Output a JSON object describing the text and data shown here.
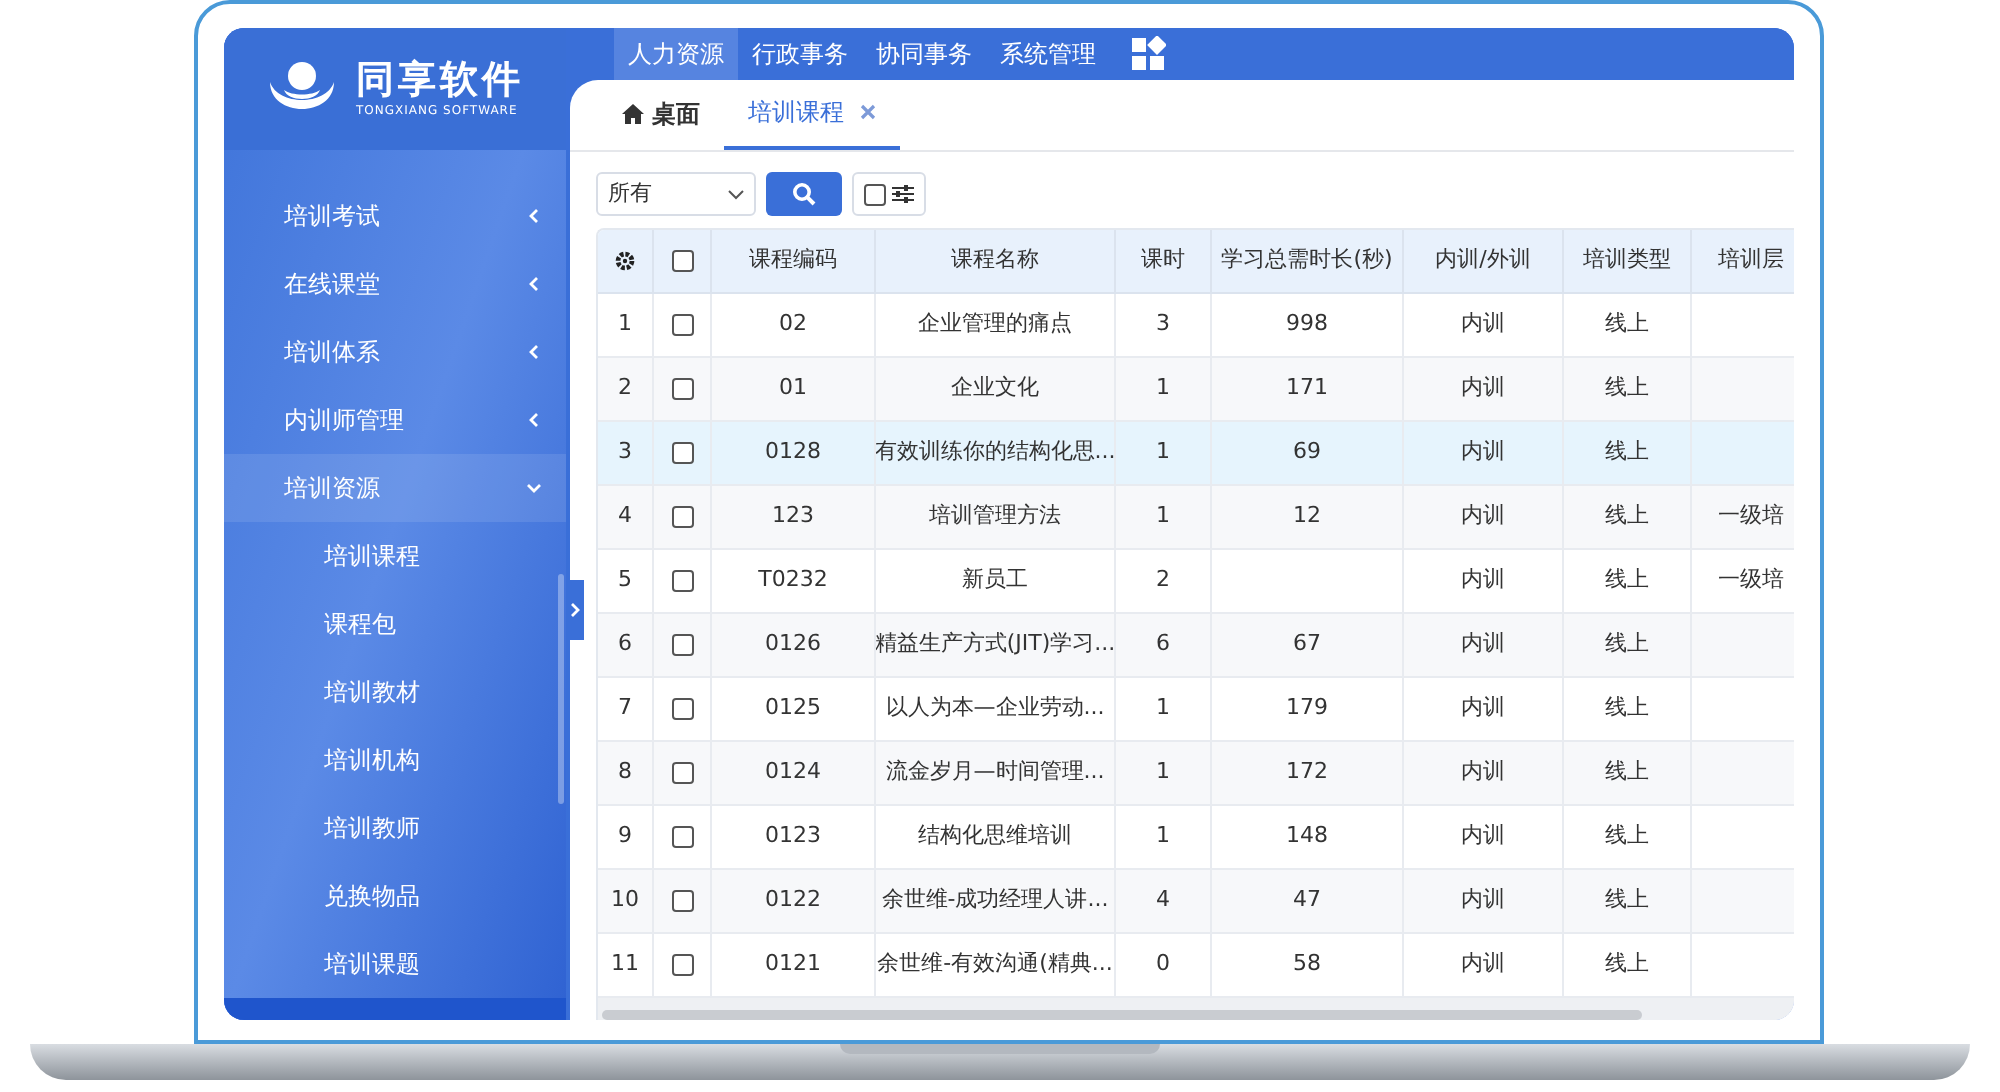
{
  "logo": {
    "name": "同享软件",
    "subtitle": "TONGXIANG SOFTWARE"
  },
  "top_nav": [
    {
      "label": "人力资源",
      "selected": true
    },
    {
      "label": "行政事务",
      "selected": false
    },
    {
      "label": "协同事务",
      "selected": false
    },
    {
      "label": "系统管理",
      "selected": false
    }
  ],
  "sidebar": {
    "items": [
      {
        "label": "培训考试",
        "expanded": false
      },
      {
        "label": "在线课堂",
        "expanded": false
      },
      {
        "label": "培训体系",
        "expanded": false
      },
      {
        "label": "内训师管理",
        "expanded": false
      },
      {
        "label": "培训资源",
        "expanded": true,
        "children": [
          {
            "label": "培训课程"
          },
          {
            "label": "课程包"
          },
          {
            "label": "培训教材"
          },
          {
            "label": "培训机构"
          },
          {
            "label": "培训教师"
          },
          {
            "label": "兑换物品"
          },
          {
            "label": "培训课题"
          }
        ]
      }
    ]
  },
  "tabs": [
    {
      "label": "桌面",
      "kind": "home",
      "selected": false
    },
    {
      "label": "培训课程",
      "kind": "closable",
      "selected": true
    }
  ],
  "toolbar": {
    "filter": "所有",
    "toggle_checked": false
  },
  "table": {
    "header_checked": false,
    "columns": [
      "",
      "",
      "课程编码",
      "课程名称",
      "课时",
      "学习总需时长(秒)",
      "内训/外训",
      "培训类型",
      "培训层"
    ],
    "rows": [
      {
        "cells": [
          "1",
          "",
          "02",
          "企业管理的痛点",
          "3",
          "998",
          "内训",
          "线上",
          ""
        ],
        "checked": false,
        "selected": false
      },
      {
        "cells": [
          "2",
          "",
          "01",
          "企业文化",
          "1",
          "171",
          "内训",
          "线上",
          ""
        ],
        "checked": false,
        "selected": false
      },
      {
        "cells": [
          "3",
          "",
          "0128",
          "有效训练你的结构化思...",
          "1",
          "69",
          "内训",
          "线上",
          ""
        ],
        "checked": false,
        "selected": true
      },
      {
        "cells": [
          "4",
          "",
          "123",
          "培训管理方法",
          "1",
          "12",
          "内训",
          "线上",
          "一级培"
        ],
        "checked": false,
        "selected": false
      },
      {
        "cells": [
          "5",
          "",
          "T0232",
          "新员工",
          "2",
          "",
          "内训",
          "线上",
          "一级培"
        ],
        "checked": false,
        "selected": false
      },
      {
        "cells": [
          "6",
          "",
          "0126",
          "精益生产方式(JIT)学习...",
          "6",
          "67",
          "内训",
          "线上",
          ""
        ],
        "checked": false,
        "selected": false
      },
      {
        "cells": [
          "7",
          "",
          "0125",
          "以人为本—企业劳动...",
          "1",
          "179",
          "内训",
          "线上",
          ""
        ],
        "checked": false,
        "selected": false
      },
      {
        "cells": [
          "8",
          "",
          "0124",
          "流金岁月—时间管理...",
          "1",
          "172",
          "内训",
          "线上",
          ""
        ],
        "checked": false,
        "selected": false
      },
      {
        "cells": [
          "9",
          "",
          "0123",
          "结构化思维培训",
          "1",
          "148",
          "内训",
          "线上",
          ""
        ],
        "checked": false,
        "selected": false
      },
      {
        "cells": [
          "10",
          "",
          "0122",
          "余世维-成功经理人讲...",
          "4",
          "47",
          "内训",
          "线上",
          ""
        ],
        "checked": false,
        "selected": false
      },
      {
        "cells": [
          "11",
          "",
          "0121",
          "余世维-有效沟通(精典...",
          "0",
          "58",
          "内训",
          "线上",
          ""
        ],
        "checked": false,
        "selected": false
      }
    ]
  }
}
